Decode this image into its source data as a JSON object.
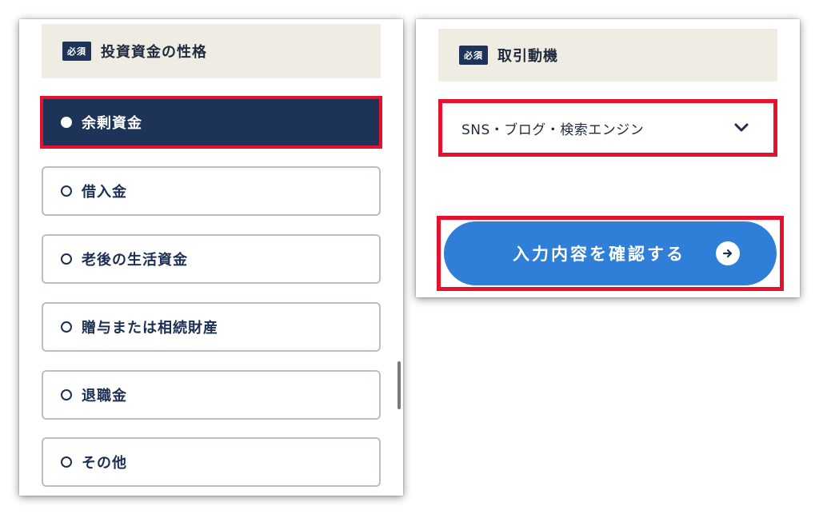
{
  "left_form": {
    "required_badge": "必須",
    "title": "投資資金の性格",
    "options": [
      {
        "label": "余剰資金",
        "selected": true
      },
      {
        "label": "借入金",
        "selected": false
      },
      {
        "label": "老後の生活資金",
        "selected": false
      },
      {
        "label": "贈与または相続財産",
        "selected": false
      },
      {
        "label": "退職金",
        "selected": false
      },
      {
        "label": "その他",
        "selected": false
      }
    ]
  },
  "right_form": {
    "required_badge": "必須",
    "title": "取引動機",
    "select_value": "SNS・ブログ・検索エンジン",
    "submit_label": "入力内容を確認する"
  },
  "colors": {
    "navy": "#1d3357",
    "highlight_red": "#e8112d",
    "header_bg": "#efede3",
    "button_blue": "#2f7ed8"
  },
  "icons": {
    "select_toggle": "chevron-down-icon",
    "submit_arrow": "arrow-right-icon"
  }
}
